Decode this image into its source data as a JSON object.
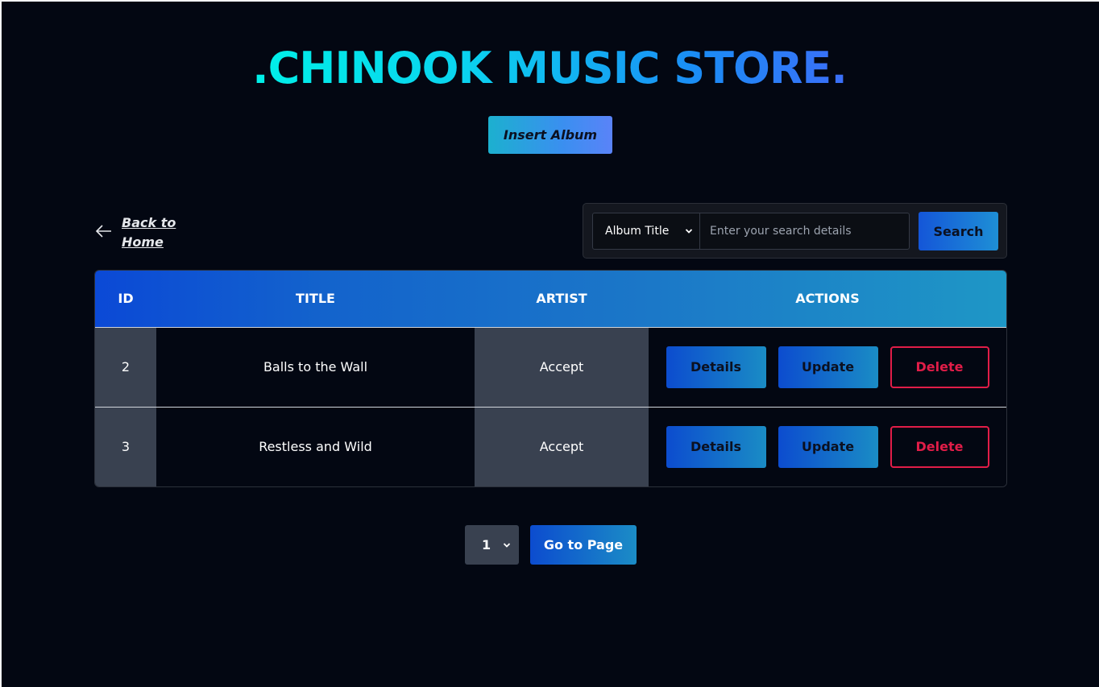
{
  "header": {
    "title": ".CHINOOK MUSIC STORE.",
    "insert_label": "Insert Album"
  },
  "nav": {
    "back_label": "Back to Home"
  },
  "search": {
    "field_selected": "Album Title",
    "placeholder": "Enter your search details",
    "button_label": "Search"
  },
  "table": {
    "columns": [
      "ID",
      "TITLE",
      "ARTIST",
      "ACTIONS"
    ],
    "rows": [
      {
        "id": "2",
        "title": "Balls to the Wall",
        "artist": "Accept"
      },
      {
        "id": "3",
        "title": "Restless and Wild",
        "artist": "Accept"
      }
    ],
    "actions": {
      "details_label": "Details",
      "update_label": "Update",
      "delete_label": "Delete"
    }
  },
  "pagination": {
    "selected_page": "1",
    "go_label": "Go to Page"
  },
  "colors": {
    "background": "#030712",
    "accent_cyan": "#00f0e8",
    "accent_blue": "#1456d8",
    "delete_red": "#e11d48",
    "cell_gray": "#394150"
  },
  "icons": {
    "back": "arrow-left-icon",
    "select": "chevron-down-icon"
  }
}
